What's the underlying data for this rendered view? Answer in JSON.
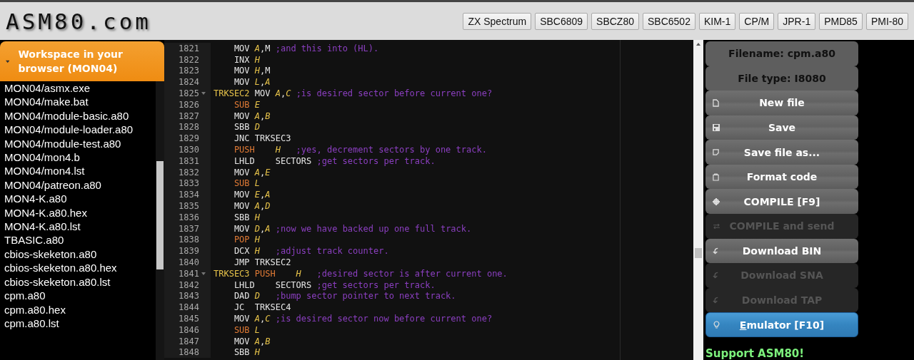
{
  "header": {
    "logo": "ASM80.com",
    "platforms": [
      "ZX Spectrum",
      "SBC6809",
      "SBCZ80",
      "SBC6502",
      "KIM-1",
      "CP/M",
      "JPR-1",
      "PMD85",
      "PMI-80"
    ]
  },
  "sidebar": {
    "title": "Workspace in your browser (MON04)",
    "expanded": true,
    "items": [
      {
        "label": "MON04/asmx.exe"
      },
      {
        "label": "MON04/make.bat"
      },
      {
        "label": "MON04/module-basic.a80"
      },
      {
        "label": "MON04/module-loader.a80"
      },
      {
        "label": "MON04/module-test.a80"
      },
      {
        "label": "MON04/mon4.b"
      },
      {
        "label": "MON04/mon4.lst"
      },
      {
        "label": "MON04/patreon.a80"
      },
      {
        "label": "MON4-K.a80"
      },
      {
        "label": "MON4-K.a80.hex"
      },
      {
        "label": "MON4-K.a80.lst"
      },
      {
        "label": "TBASIC.a80"
      },
      {
        "label": "cbios-skeketon.a80"
      },
      {
        "label": "cbios-skeketon.a80.hex"
      },
      {
        "label": "cbios-skeketon.a80.lst"
      },
      {
        "label": "cpm.a80"
      },
      {
        "label": "cpm.a80.hex"
      },
      {
        "label": "cpm.a80.lst"
      }
    ]
  },
  "editor": {
    "lines": [
      {
        "number": "1821",
        "foldable": false,
        "tokens": [
          {
            "kind": "plain",
            "text": "MOV "
          },
          {
            "kind": "register",
            "text": "A"
          },
          {
            "kind": "plain",
            "text": ",M "
          },
          {
            "kind": "comment",
            "text": ";and this into (HL)."
          }
        ]
      },
      {
        "number": "1822",
        "foldable": false,
        "tokens": [
          {
            "kind": "plain",
            "text": "INX "
          },
          {
            "kind": "register",
            "text": "H"
          }
        ]
      },
      {
        "number": "1823",
        "foldable": false,
        "tokens": [
          {
            "kind": "plain",
            "text": "MOV "
          },
          {
            "kind": "register",
            "text": "H"
          },
          {
            "kind": "plain",
            "text": ",M"
          }
        ]
      },
      {
        "number": "1824",
        "foldable": false,
        "tokens": [
          {
            "kind": "plain",
            "text": "MOV "
          },
          {
            "kind": "register",
            "text": "L"
          },
          {
            "kind": "plain",
            "text": ","
          },
          {
            "kind": "register",
            "text": "A"
          }
        ]
      },
      {
        "number": "1825",
        "foldable": true,
        "tokens": [
          {
            "kind": "label",
            "text": "TRKSEC2 "
          },
          {
            "kind": "plain",
            "text": "MOV "
          },
          {
            "kind": "register",
            "text": "A"
          },
          {
            "kind": "plain",
            "text": ","
          },
          {
            "kind": "register",
            "text": "C "
          },
          {
            "kind": "comment",
            "text": ";is desired sector before current one?"
          }
        ]
      },
      {
        "number": "1826",
        "foldable": false,
        "tokens": [
          {
            "kind": "stack",
            "text": "SUB "
          },
          {
            "kind": "register",
            "text": "E"
          }
        ]
      },
      {
        "number": "1827",
        "foldable": false,
        "tokens": [
          {
            "kind": "plain",
            "text": "MOV "
          },
          {
            "kind": "register",
            "text": "A"
          },
          {
            "kind": "plain",
            "text": ","
          },
          {
            "kind": "register",
            "text": "B"
          }
        ]
      },
      {
        "number": "1828",
        "foldable": false,
        "tokens": [
          {
            "kind": "plain",
            "text": "SBB "
          },
          {
            "kind": "register",
            "text": "D"
          }
        ]
      },
      {
        "number": "1829",
        "foldable": false,
        "tokens": [
          {
            "kind": "plain",
            "text": "JNC TRKSEC3"
          }
        ]
      },
      {
        "number": "1830",
        "foldable": false,
        "tokens": [
          {
            "kind": "stack",
            "text": "PUSH    "
          },
          {
            "kind": "register",
            "text": "H   "
          },
          {
            "kind": "comment",
            "text": ";yes, decrement sectors by one track."
          }
        ]
      },
      {
        "number": "1831",
        "foldable": false,
        "tokens": [
          {
            "kind": "plain",
            "text": "LHLD    SECTORS "
          },
          {
            "kind": "comment",
            "text": ";get sectors per track."
          }
        ]
      },
      {
        "number": "1832",
        "foldable": false,
        "tokens": [
          {
            "kind": "plain",
            "text": "MOV "
          },
          {
            "kind": "register",
            "text": "A"
          },
          {
            "kind": "plain",
            "text": ","
          },
          {
            "kind": "register",
            "text": "E"
          }
        ]
      },
      {
        "number": "1833",
        "foldable": false,
        "tokens": [
          {
            "kind": "stack",
            "text": "SUB "
          },
          {
            "kind": "register",
            "text": "L"
          }
        ]
      },
      {
        "number": "1834",
        "foldable": false,
        "tokens": [
          {
            "kind": "plain",
            "text": "MOV "
          },
          {
            "kind": "register",
            "text": "E"
          },
          {
            "kind": "plain",
            "text": ","
          },
          {
            "kind": "register",
            "text": "A"
          }
        ]
      },
      {
        "number": "1835",
        "foldable": false,
        "tokens": [
          {
            "kind": "plain",
            "text": "MOV "
          },
          {
            "kind": "register",
            "text": "A"
          },
          {
            "kind": "plain",
            "text": ","
          },
          {
            "kind": "register",
            "text": "D"
          }
        ]
      },
      {
        "number": "1836",
        "foldable": false,
        "tokens": [
          {
            "kind": "plain",
            "text": "SBB "
          },
          {
            "kind": "register",
            "text": "H"
          }
        ]
      },
      {
        "number": "1837",
        "foldable": false,
        "tokens": [
          {
            "kind": "plain",
            "text": "MOV "
          },
          {
            "kind": "register",
            "text": "D"
          },
          {
            "kind": "plain",
            "text": ","
          },
          {
            "kind": "register",
            "text": "A "
          },
          {
            "kind": "comment",
            "text": ";now we have backed up one full track."
          }
        ]
      },
      {
        "number": "1838",
        "foldable": false,
        "tokens": [
          {
            "kind": "stack",
            "text": "POP "
          },
          {
            "kind": "register",
            "text": "H"
          }
        ]
      },
      {
        "number": "1839",
        "foldable": false,
        "tokens": [
          {
            "kind": "plain",
            "text": "DCX "
          },
          {
            "kind": "register",
            "text": "H   "
          },
          {
            "kind": "comment",
            "text": ";adjust track counter."
          }
        ]
      },
      {
        "number": "1840",
        "foldable": false,
        "tokens": [
          {
            "kind": "plain",
            "text": "JMP TRKSEC2"
          }
        ]
      },
      {
        "number": "1841",
        "foldable": true,
        "tokens": [
          {
            "kind": "label",
            "text": "TRKSEC3 "
          },
          {
            "kind": "stack",
            "text": "PUSH    "
          },
          {
            "kind": "register",
            "text": "H   "
          },
          {
            "kind": "comment",
            "text": ";desired sector is after current one."
          }
        ]
      },
      {
        "number": "1842",
        "foldable": false,
        "tokens": [
          {
            "kind": "plain",
            "text": "LHLD    SECTORS "
          },
          {
            "kind": "comment",
            "text": ";get sectors per track."
          }
        ]
      },
      {
        "number": "1843",
        "foldable": false,
        "tokens": [
          {
            "kind": "plain",
            "text": "DAD "
          },
          {
            "kind": "register",
            "text": "D   "
          },
          {
            "kind": "comment",
            "text": ";bump sector pointer to next track."
          }
        ]
      },
      {
        "number": "1844",
        "foldable": false,
        "tokens": [
          {
            "kind": "plain",
            "text": "JC  TRKSEC4"
          }
        ]
      },
      {
        "number": "1845",
        "foldable": false,
        "tokens": [
          {
            "kind": "plain",
            "text": "MOV "
          },
          {
            "kind": "register",
            "text": "A"
          },
          {
            "kind": "plain",
            "text": ","
          },
          {
            "kind": "register",
            "text": "C "
          },
          {
            "kind": "comment",
            "text": ";is desired sector now before current one?"
          }
        ]
      },
      {
        "number": "1846",
        "foldable": false,
        "tokens": [
          {
            "kind": "stack",
            "text": "SUB "
          },
          {
            "kind": "register",
            "text": "L"
          }
        ]
      },
      {
        "number": "1847",
        "foldable": false,
        "tokens": [
          {
            "kind": "plain",
            "text": "MOV "
          },
          {
            "kind": "register",
            "text": "A"
          },
          {
            "kind": "plain",
            "text": ","
          },
          {
            "kind": "register",
            "text": "B"
          }
        ]
      },
      {
        "number": "1848",
        "foldable": false,
        "tokens": [
          {
            "kind": "plain",
            "text": "SBB "
          },
          {
            "kind": "register",
            "text": "H"
          }
        ]
      }
    ]
  },
  "panel": {
    "buttons": [
      {
        "kind": "info",
        "label": "Filename: cpm.a80"
      },
      {
        "kind": "info",
        "label": "File type: I8080"
      },
      {
        "kind": "action",
        "label": "New file",
        "disabled": false
      },
      {
        "kind": "action",
        "label": "Save",
        "disabled": false
      },
      {
        "kind": "action",
        "label": "Save file as...",
        "disabled": false
      },
      {
        "kind": "action",
        "label": "Format code",
        "disabled": false
      },
      {
        "kind": "action",
        "label": "COMPILE [F9]",
        "disabled": false
      },
      {
        "kind": "action",
        "label": "COMPILE and send",
        "disabled": true
      },
      {
        "kind": "action",
        "label": "Download BIN",
        "disabled": false
      },
      {
        "kind": "action",
        "label": "Download SNA",
        "disabled": true
      },
      {
        "kind": "action",
        "label": "Download TAP",
        "disabled": true
      },
      {
        "kind": "primary",
        "label": "Emulator [F10]",
        "disabled": false
      }
    ],
    "support": "Support ASM80!"
  }
}
